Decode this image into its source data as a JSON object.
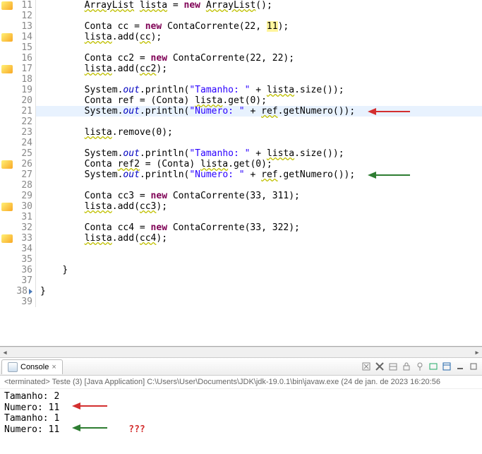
{
  "lines": [
    {
      "num": "11",
      "marker": true,
      "indent": "        ",
      "tokens": [
        {
          "t": "ArrayList",
          "c": "warn-under"
        },
        {
          "t": " "
        },
        {
          "t": "lista",
          "c": "wavy"
        },
        {
          "t": " = "
        },
        {
          "t": "new",
          "c": "kw"
        },
        {
          "t": " "
        },
        {
          "t": "ArrayList",
          "c": "warn-under"
        },
        {
          "t": "();"
        }
      ]
    },
    {
      "num": "12",
      "marker": false,
      "indent": "",
      "tokens": []
    },
    {
      "num": "13",
      "marker": false,
      "indent": "        ",
      "tokens": [
        {
          "t": "Conta cc = "
        },
        {
          "t": "new",
          "c": "kw"
        },
        {
          "t": " ContaCorrente(22, "
        },
        {
          "t": "11",
          "c": "hl-token"
        },
        {
          "t": ");"
        }
      ]
    },
    {
      "num": "14",
      "marker": true,
      "indent": "        ",
      "tokens": [
        {
          "t": "lista",
          "c": "wavy"
        },
        {
          "t": ".add("
        },
        {
          "t": "cc",
          "c": "wavy"
        },
        {
          "t": ");"
        }
      ]
    },
    {
      "num": "15",
      "marker": false,
      "indent": "",
      "tokens": []
    },
    {
      "num": "16",
      "marker": false,
      "indent": "        ",
      "tokens": [
        {
          "t": "Conta cc2 = "
        },
        {
          "t": "new",
          "c": "kw"
        },
        {
          "t": " ContaCorrente(22, 22);"
        }
      ]
    },
    {
      "num": "17",
      "marker": true,
      "indent": "        ",
      "tokens": [
        {
          "t": "lista",
          "c": "wavy"
        },
        {
          "t": ".add("
        },
        {
          "t": "cc2",
          "c": "wavy"
        },
        {
          "t": ");"
        }
      ]
    },
    {
      "num": "18",
      "marker": false,
      "indent": "",
      "tokens": []
    },
    {
      "num": "19",
      "marker": false,
      "indent": "        ",
      "tokens": [
        {
          "t": "System."
        },
        {
          "t": "out",
          "c": "field-italic"
        },
        {
          "t": ".println("
        },
        {
          "t": "\"Tamanho: \"",
          "c": "str"
        },
        {
          "t": " + "
        },
        {
          "t": "lista",
          "c": "wavy"
        },
        {
          "t": ".size());"
        }
      ]
    },
    {
      "num": "20",
      "marker": false,
      "indent": "        ",
      "tokens": [
        {
          "t": "Conta ref = (Conta) "
        },
        {
          "t": "lista",
          "c": "wavy"
        },
        {
          "t": ".get(0);"
        }
      ]
    },
    {
      "num": "21",
      "marker": false,
      "hl": true,
      "indent": "        ",
      "tokens": [
        {
          "t": "System."
        },
        {
          "t": "out",
          "c": "field-italic"
        },
        {
          "t": ".println("
        },
        {
          "t": "\"Numero: \"",
          "c": "str"
        },
        {
          "t": " + "
        },
        {
          "t": "ref",
          "c": "wavy"
        },
        {
          "t": ".getNumero());"
        }
      ],
      "arrow": "red"
    },
    {
      "num": "22",
      "marker": false,
      "indent": "",
      "tokens": []
    },
    {
      "num": "23",
      "marker": false,
      "indent": "        ",
      "tokens": [
        {
          "t": "lista",
          "c": "wavy"
        },
        {
          "t": ".remove(0);"
        }
      ]
    },
    {
      "num": "24",
      "marker": false,
      "indent": "",
      "tokens": []
    },
    {
      "num": "25",
      "marker": false,
      "indent": "        ",
      "tokens": [
        {
          "t": "System."
        },
        {
          "t": "out",
          "c": "field-italic"
        },
        {
          "t": ".println("
        },
        {
          "t": "\"Tamanho: \"",
          "c": "str"
        },
        {
          "t": " + "
        },
        {
          "t": "lista",
          "c": "wavy"
        },
        {
          "t": ".size());"
        }
      ]
    },
    {
      "num": "26",
      "marker": true,
      "indent": "        ",
      "tokens": [
        {
          "t": "Conta "
        },
        {
          "t": "ref2",
          "c": "warn-under"
        },
        {
          "t": " = (Conta) "
        },
        {
          "t": "lista",
          "c": "wavy"
        },
        {
          "t": ".get(0);"
        }
      ]
    },
    {
      "num": "27",
      "marker": false,
      "indent": "        ",
      "tokens": [
        {
          "t": "System."
        },
        {
          "t": "out",
          "c": "field-italic"
        },
        {
          "t": ".println("
        },
        {
          "t": "\"Numero: \"",
          "c": "str"
        },
        {
          "t": " + "
        },
        {
          "t": "ref",
          "c": "wavy"
        },
        {
          "t": ".getNumero());"
        }
      ],
      "arrow": "green"
    },
    {
      "num": "28",
      "marker": false,
      "indent": "",
      "tokens": []
    },
    {
      "num": "29",
      "marker": false,
      "indent": "        ",
      "tokens": [
        {
          "t": "Conta cc3 = "
        },
        {
          "t": "new",
          "c": "kw"
        },
        {
          "t": " ContaCorrente(33, 311);"
        }
      ]
    },
    {
      "num": "30",
      "marker": true,
      "indent": "        ",
      "tokens": [
        {
          "t": "lista",
          "c": "wavy"
        },
        {
          "t": ".add("
        },
        {
          "t": "cc3",
          "c": "wavy"
        },
        {
          "t": ");"
        }
      ]
    },
    {
      "num": "31",
      "marker": false,
      "indent": "",
      "tokens": []
    },
    {
      "num": "32",
      "marker": false,
      "indent": "        ",
      "tokens": [
        {
          "t": "Conta cc4 = "
        },
        {
          "t": "new",
          "c": "kw"
        },
        {
          "t": " ContaCorrente(33, 322);"
        }
      ]
    },
    {
      "num": "33",
      "marker": true,
      "indent": "        ",
      "tokens": [
        {
          "t": "lista",
          "c": "wavy"
        },
        {
          "t": ".add("
        },
        {
          "t": "cc4",
          "c": "wavy"
        },
        {
          "t": ");"
        }
      ]
    },
    {
      "num": "34",
      "marker": false,
      "indent": "",
      "tokens": []
    },
    {
      "num": "35",
      "marker": false,
      "indent": "",
      "tokens": []
    },
    {
      "num": "36",
      "marker": false,
      "indent": "    ",
      "tokens": [
        {
          "t": "}"
        }
      ]
    },
    {
      "num": "37",
      "marker": false,
      "indent": "",
      "tokens": []
    },
    {
      "num": "38",
      "marker": false,
      "indent": "",
      "tokens": [
        {
          "t": "}"
        }
      ],
      "triangle": true
    },
    {
      "num": "39",
      "marker": false,
      "indent": "",
      "tokens": []
    }
  ],
  "lineNumbers": [
    "11",
    "12",
    "13",
    "14",
    "15",
    "16",
    "17",
    "18",
    "19",
    "20",
    "21",
    "22",
    "23",
    "24",
    "25",
    "26",
    "27",
    "28",
    "29",
    "30",
    "31",
    "32",
    "33",
    "34",
    "35",
    "36",
    "37",
    "38",
    "39"
  ],
  "lineNumberMap": {
    "11": "11",
    "12": "13",
    "13": "14",
    "14": "15",
    "15": "16",
    "16": "17",
    "17": "18",
    "18": "19",
    "19": "20",
    "20": "21",
    "21": "22",
    "22": "23",
    "23": "24",
    "24": "25",
    "25": "26",
    "26": "27",
    "27": "28",
    "28": "29",
    "29": "30",
    "30": "31",
    "31": "32",
    "32": "33",
    "33": "34",
    "34": "35",
    "35": "36",
    "36": "37",
    "37": "38",
    "38": "39",
    "39": ""
  },
  "console": {
    "tab_label": "Console",
    "header": "<terminated> Teste (3) [Java Application] C:\\Users\\User\\Documents\\JDK\\jdk-19.0.1\\bin\\javaw.exe (24 de jan. de 2023 16:20:56",
    "out": [
      {
        "text": "Tamanho: 2"
      },
      {
        "text": "Numero: 11",
        "arrow": "red"
      },
      {
        "text": "Tamanho: 1"
      },
      {
        "text": "Numero: 11",
        "arrow": "green",
        "q": "???"
      }
    ]
  },
  "icons": {
    "remove_all": "✕✕",
    "remove": "✕",
    "pin": "📌",
    "display": "▭",
    "open": "▤",
    "min": "_",
    "max": "▢"
  }
}
